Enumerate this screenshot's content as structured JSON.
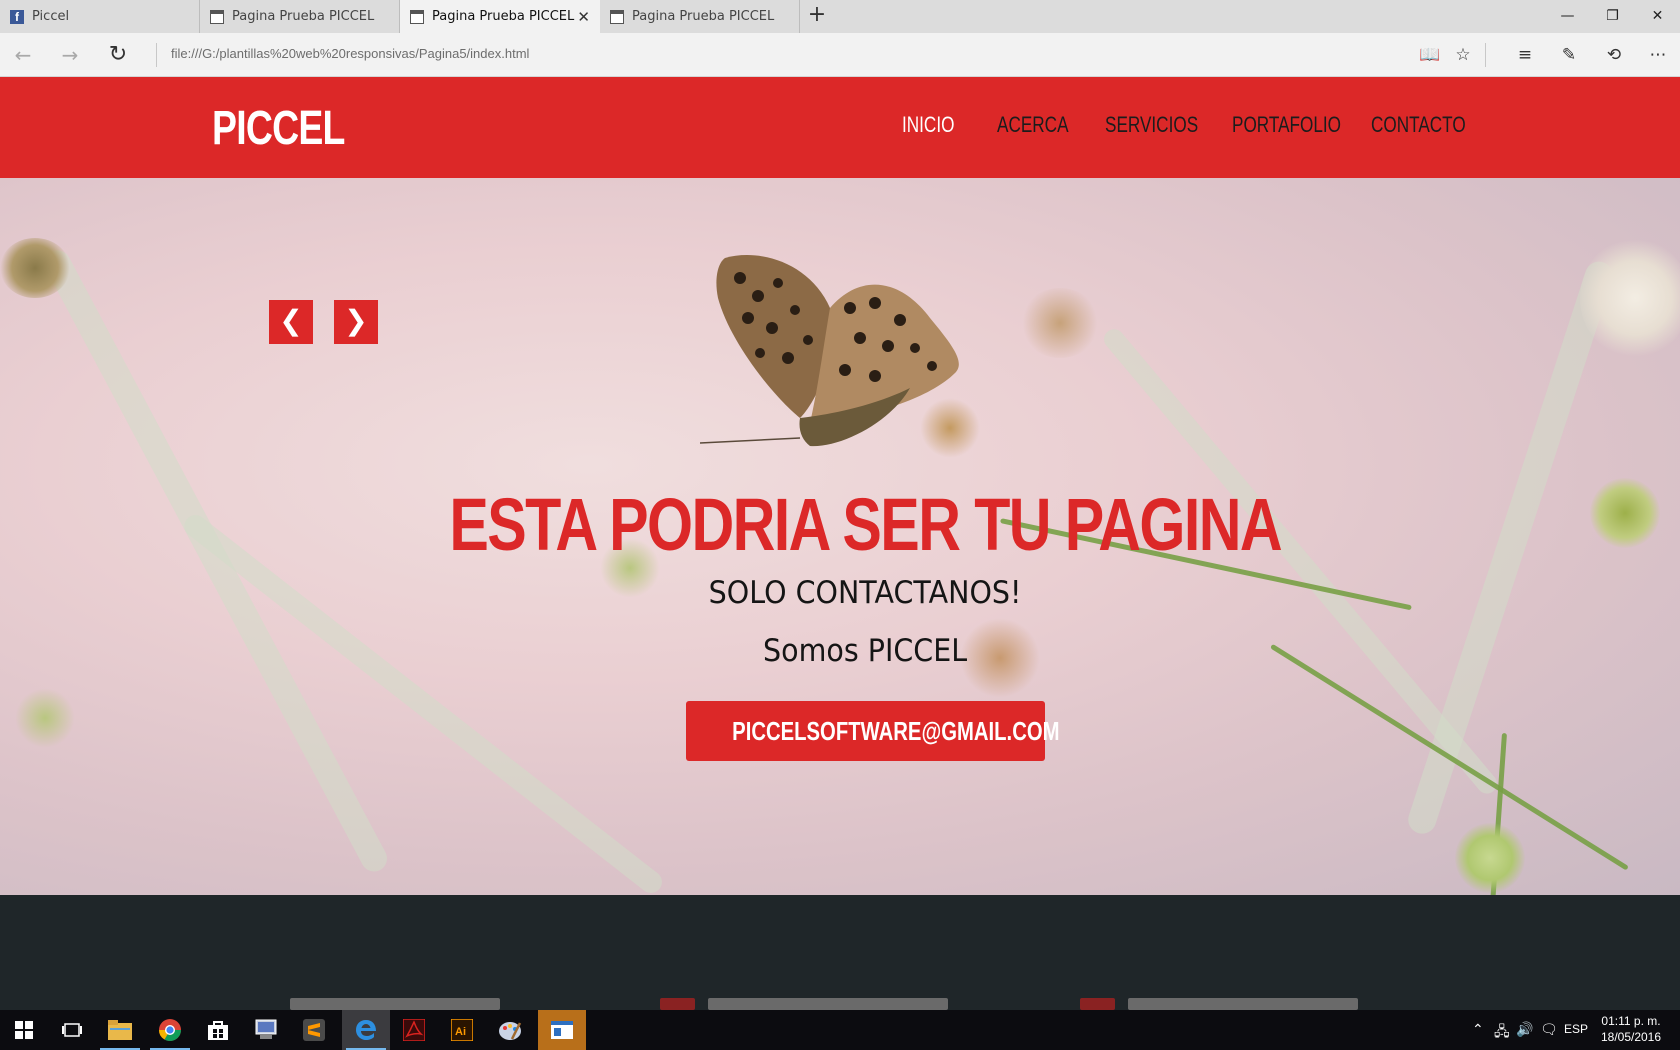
{
  "browser": {
    "tabs": [
      {
        "title": "Piccel",
        "icon": "facebook-icon"
      },
      {
        "title": "Pagina Prueba PICCEL",
        "icon": "page-icon"
      },
      {
        "title": "Pagina Prueba PICCEL",
        "icon": "page-icon",
        "active": true
      },
      {
        "title": "Pagina Prueba PICCEL",
        "icon": "page-icon"
      }
    ],
    "url": "file:///G:/plantillas%20web%20responsivas/Pagina5/index.html"
  },
  "site": {
    "logo": "PICCEL",
    "nav": [
      "INICIO",
      "ACERCA",
      "SERVICIOS",
      "PORTAFOLIO",
      "CONTACTO"
    ],
    "active_nav": "INICIO",
    "brand_color": "#dc2828",
    "hero": {
      "prev_label": "❮",
      "next_label": "❯",
      "title": "ESTA PODRIA SER TU PAGINA",
      "subtitle": "SOLO CONTACTANOS!",
      "tagline": "Somos PICCEL",
      "cta": "PICCELSOFTWARE@GMAIL.COM"
    }
  },
  "taskbar": {
    "language": "ESP",
    "time": "01:11 p. m.",
    "date": "18/05/2016"
  }
}
